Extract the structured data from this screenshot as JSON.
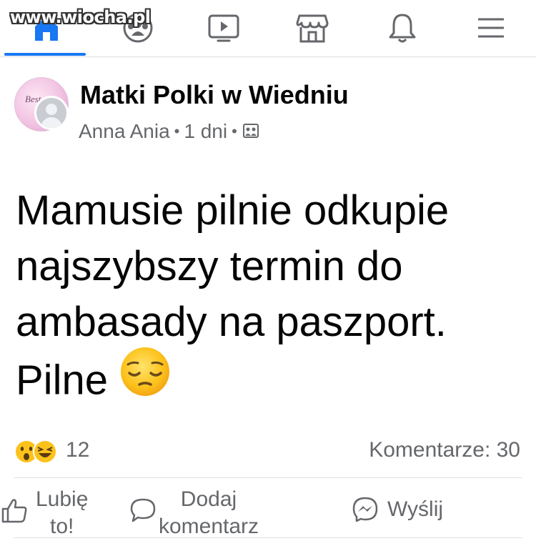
{
  "watermark": "www.wiocha.pl",
  "nav": {
    "items": [
      {
        "name": "home",
        "icon": "home-icon"
      },
      {
        "name": "groups",
        "icon": "groups-icon"
      },
      {
        "name": "watch",
        "icon": "video-icon"
      },
      {
        "name": "marketplace",
        "icon": "store-icon"
      },
      {
        "name": "notifications",
        "icon": "bell-icon"
      },
      {
        "name": "menu",
        "icon": "hamburger-menu-icon"
      }
    ],
    "accent_color": "#1877f2"
  },
  "post": {
    "group_name": "Matki Polki w Wiedniu",
    "author": "Anna Ania",
    "separator": "•",
    "time": "1 dni",
    "privacy_icon": "private-group-icon",
    "avatar_script": "Best",
    "text_lines": [
      "Mamusie pilnie odkupie",
      "najszybszy termin do",
      "ambasady na paszport.",
      "Pilne"
    ],
    "emoji": "pensive-face",
    "reaction_icons": [
      "wow-emoji",
      "haha-emoji"
    ],
    "reaction_count": "12",
    "comments": "Komentarze: 30"
  },
  "actions": {
    "like": {
      "line1": "Lubię",
      "line2": "to!",
      "icon": "thumbs-up-icon"
    },
    "comment": {
      "line1": "Dodaj",
      "line2": "komentarz",
      "icon": "comment-bubble-icon"
    },
    "send": {
      "label": "Wyślij",
      "icon": "messenger-icon"
    }
  },
  "colors": {
    "text": "#050505",
    "secondary": "#65676b",
    "divider": "#dadde1"
  }
}
